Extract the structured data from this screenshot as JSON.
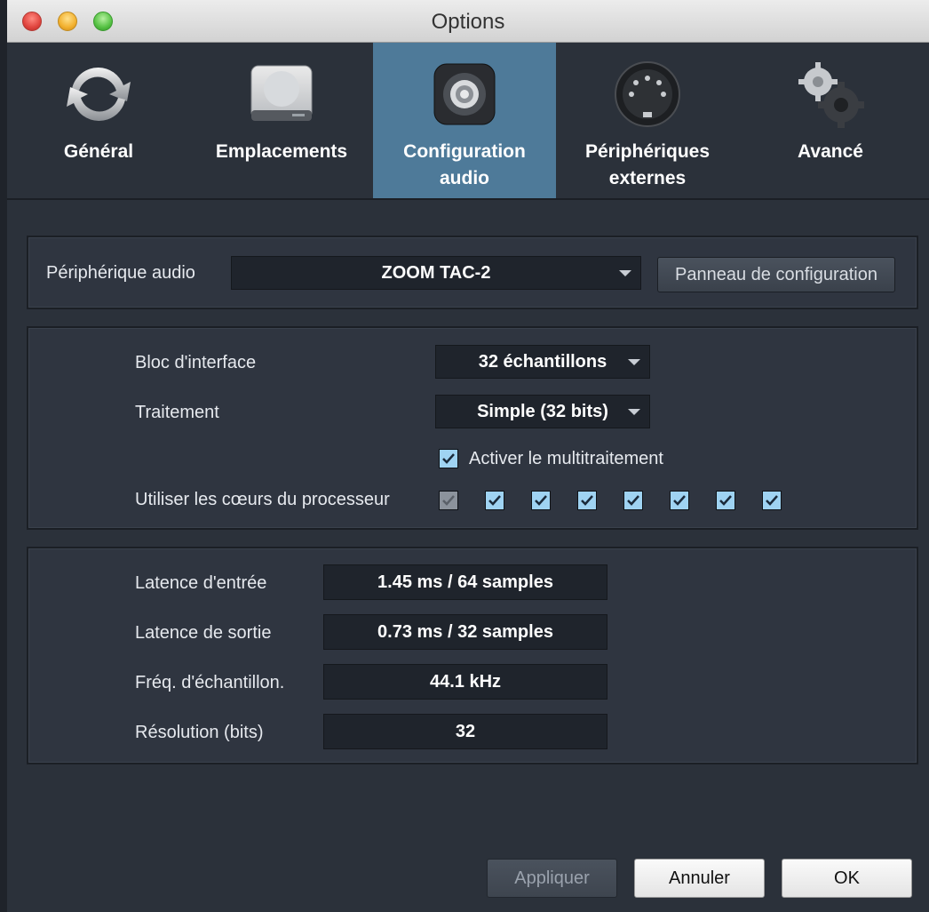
{
  "window": {
    "title": "Options"
  },
  "tabs": [
    {
      "label": "Général",
      "icon": "refresh-icon"
    },
    {
      "label": "Emplacements",
      "icon": "drive-icon"
    },
    {
      "label": "Configuration audio",
      "icon": "speaker-icon"
    },
    {
      "label": "Périphériques externes",
      "icon": "midi-connector-icon"
    },
    {
      "label": "Avancé",
      "icon": "gears-icon"
    }
  ],
  "device": {
    "label": "Périphérique audio",
    "selected": "ZOOM TAC-2",
    "config_button": "Panneau de configuration"
  },
  "processing": {
    "block_label": "Bloc d'interface",
    "block_value": "32 échantillons",
    "processing_label": "Traitement",
    "processing_value": "Simple (32 bits)",
    "multiprocessing_label": "Activer le multitraitement",
    "multiprocessing_checked": true,
    "cores_label": "Utiliser les cœurs du processeur",
    "cores": [
      true,
      true,
      true,
      true,
      true,
      true,
      true,
      true
    ]
  },
  "latency": {
    "input_label": "Latence d'entrée",
    "input_value": "1.45 ms / 64 samples",
    "output_label": "Latence de sortie",
    "output_value": "0.73 ms / 32 samples",
    "rate_label": "Fréq. d'échantillon.",
    "rate_value": "44.1 kHz",
    "resolution_label": "Résolution (bits)",
    "resolution_value": "32"
  },
  "footer": {
    "apply": "Appliquer",
    "cancel": "Annuler",
    "ok": "OK"
  },
  "colors": {
    "active_tab": "#4e7a99",
    "checkbox": "#9fd3f2",
    "background": "#2b313a"
  }
}
